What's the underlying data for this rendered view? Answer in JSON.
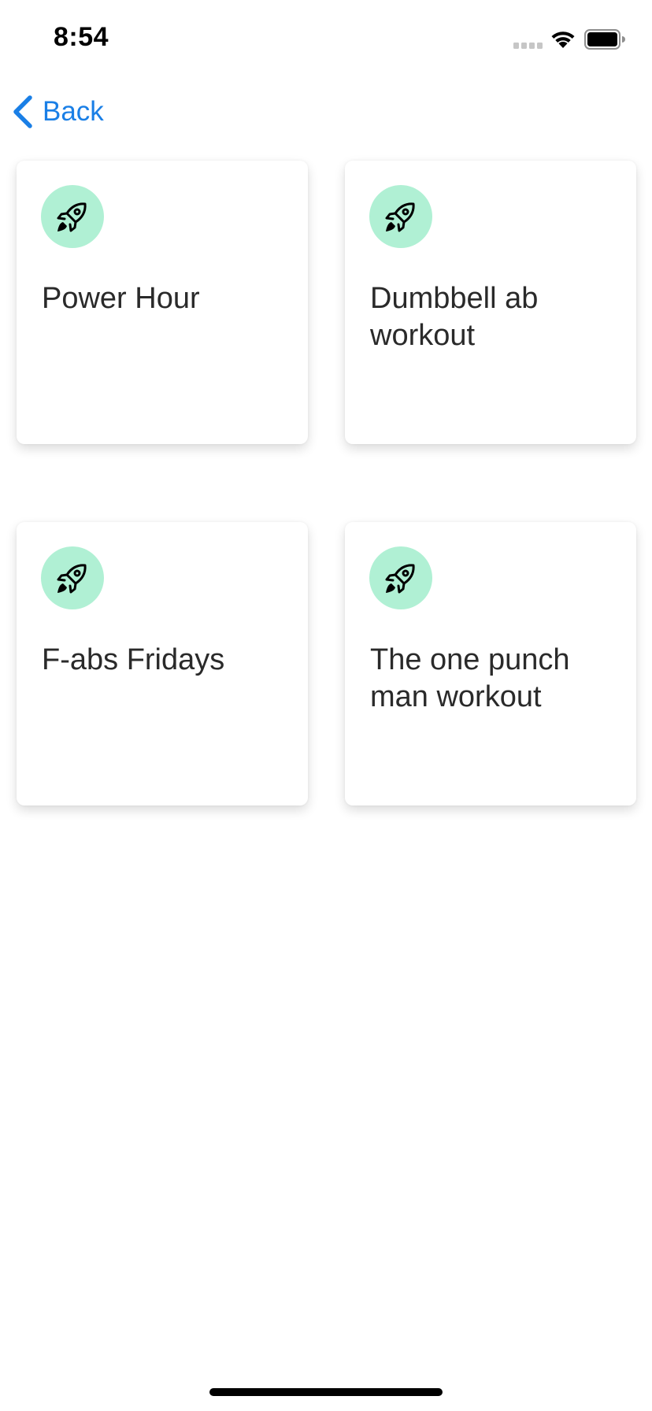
{
  "status_bar": {
    "time": "8:54"
  },
  "nav": {
    "back_label": "Back"
  },
  "colors": {
    "accent": "#1a7fe6",
    "icon_bg": "#b0f0d4",
    "text": "#2a2a2a"
  },
  "workouts": [
    {
      "title": "Power Hour",
      "icon": "rocket-icon"
    },
    {
      "title": "Dumbbell ab workout",
      "icon": "rocket-icon"
    },
    {
      "title": "F-abs Fridays",
      "icon": "rocket-icon"
    },
    {
      "title": "The one punch man workout",
      "icon": "rocket-icon"
    }
  ]
}
